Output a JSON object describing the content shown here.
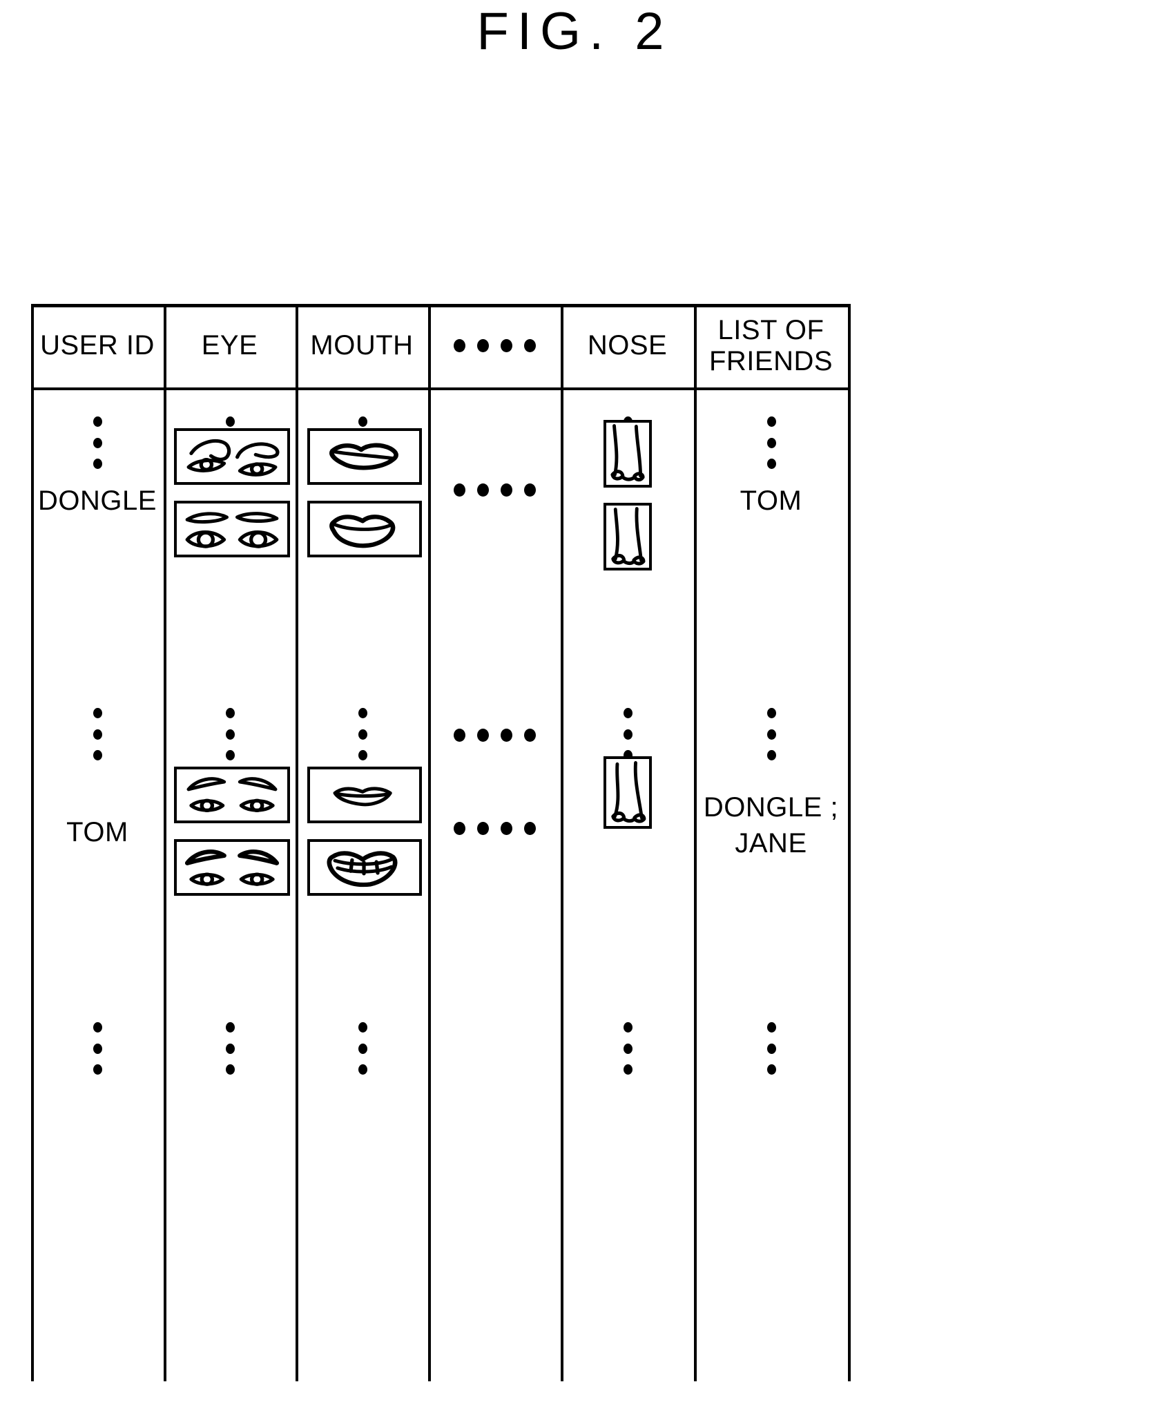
{
  "figure": {
    "title": "FIG. 2",
    "type": "patent-table-figure",
    "description": "Database table of facial feature images per user"
  },
  "table": {
    "columns": [
      {
        "key": "user_id",
        "label": "USER ID",
        "type": "text"
      },
      {
        "key": "eye",
        "label": "EYE",
        "type": "image"
      },
      {
        "key": "mouth",
        "label": "MOUTH",
        "type": "image"
      },
      {
        "key": "ellipsis",
        "label": "••••",
        "type": "ellipsis"
      },
      {
        "key": "nose",
        "label": "NOSE",
        "type": "image"
      },
      {
        "key": "friends",
        "label": "LIST OF FRIENDS",
        "type": "text"
      }
    ],
    "header_lines": {
      "user_id": [
        "USER ID"
      ],
      "eye": [
        "EYE"
      ],
      "mouth": [
        "MOUTH"
      ],
      "ellipsis": [
        "••••"
      ],
      "nose": [
        "NOSE"
      ],
      "friends": [
        "LIST OF",
        "FRIENDS"
      ]
    },
    "rows": [
      {
        "kind": "ellipsis",
        "user_id": "⋮",
        "eye": "⋮",
        "mouth": "⋮",
        "ellipsis": "",
        "nose": "⋮",
        "friends": "⋮"
      },
      {
        "kind": "data",
        "user_id": "DONGLE",
        "eye_images": [
          "eyes-almond-open-icon",
          "eyes-round-flat-brow-icon"
        ],
        "mouth_images": [
          "lips-closed-smile-icon",
          "lips-open-curve-icon"
        ],
        "ellipsis": "••••",
        "nose_images": [
          "nose-narrow-icon",
          "nose-wide-icon"
        ],
        "friends": [
          "TOM"
        ]
      },
      {
        "kind": "ellipsis",
        "user_id": "⋮",
        "eye": "⋮",
        "mouth": "⋮",
        "ellipsis": "••••",
        "nose": "⋮",
        "friends": "⋮"
      },
      {
        "kind": "data",
        "user_id": "TOM",
        "eye_images": [
          "eyes-arched-brow-icon",
          "eyes-thick-brow-icon"
        ],
        "mouth_images": [
          "lips-thin-closed-icon",
          "lips-teeth-smile-icon"
        ],
        "ellipsis": "••••",
        "nose_images": [
          "nose-tall-icon"
        ],
        "friends": [
          "DONGLE ;",
          "JANE"
        ]
      },
      {
        "kind": "ellipsis",
        "user_id": "⋮",
        "eye": "⋮",
        "mouth": "⋮",
        "ellipsis": "",
        "nose": "⋮",
        "friends": "⋮"
      }
    ]
  },
  "colors": {
    "ink": "#000000",
    "paper": "#ffffff"
  }
}
